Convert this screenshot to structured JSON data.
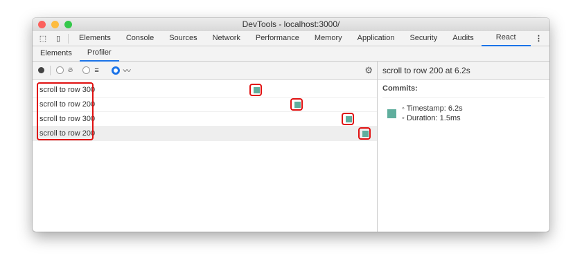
{
  "window": {
    "title": "DevTools - localhost:3000/"
  },
  "tabs": [
    "Elements",
    "Console",
    "Sources",
    "Network",
    "Performance",
    "Memory",
    "Application",
    "Security",
    "Audits",
    "React"
  ],
  "active_tab": "React",
  "subtabs": [
    "Elements",
    "Profiler"
  ],
  "active_subtab": "Profiler",
  "toolbar": {
    "icons": [
      "record-icon",
      "flame-icon",
      "ranked-icon",
      "interactions-icon",
      "gear-icon"
    ],
    "selected_view": "interactions"
  },
  "interactions": [
    {
      "label": "scroll to row 300",
      "commit_pos": 0.66
    },
    {
      "label": "scroll to row 200",
      "commit_pos": 0.78
    },
    {
      "label": "scroll to row 300",
      "commit_pos": 0.93
    },
    {
      "label": "scroll to row 200",
      "commit_pos": 0.98
    }
  ],
  "detail": {
    "title": "scroll to row 200 at 6.2s",
    "commits_label": "Commits:",
    "timestamp": "Timestamp: 6.2s",
    "duration": "Duration: 1.5ms"
  },
  "colors": {
    "accent": "#1a73e8",
    "commit": "#5fae9d",
    "highlight": "#e01010"
  }
}
